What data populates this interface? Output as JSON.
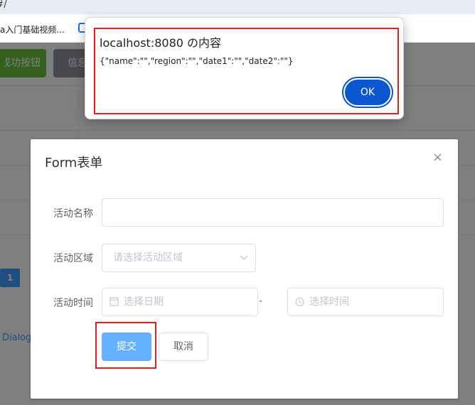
{
  "browser": {
    "url_fragment": "/#/",
    "bookmark_label": "a入门基础视频..."
  },
  "page": {
    "success_button": "成功按钮",
    "info_button": "信息",
    "pagination_current": "1",
    "dialog_link": "Dialog"
  },
  "dialog": {
    "title": "Form表单",
    "close_symbol": "×",
    "fields": {
      "name_label": "活动名称",
      "name_value": "",
      "region_label": "活动区域",
      "region_placeholder": "请选择活动区域",
      "time_label": "活动时间",
      "date_placeholder": "选择日期",
      "time_placeholder": "选择时间",
      "range_separator": "-"
    },
    "submit_label": "提交",
    "cancel_label": "取消"
  },
  "alert": {
    "title": "localhost:8080 の内容",
    "message": "{\"name\":\"\",\"region\":\"\",\"date1\":\"\",\"date2\":\"\"}",
    "ok_label": "OK"
  },
  "colors": {
    "highlight_box": "#e02020",
    "primary": "#409eff",
    "success": "#67c23a",
    "alert_button": "#0b57d0"
  }
}
